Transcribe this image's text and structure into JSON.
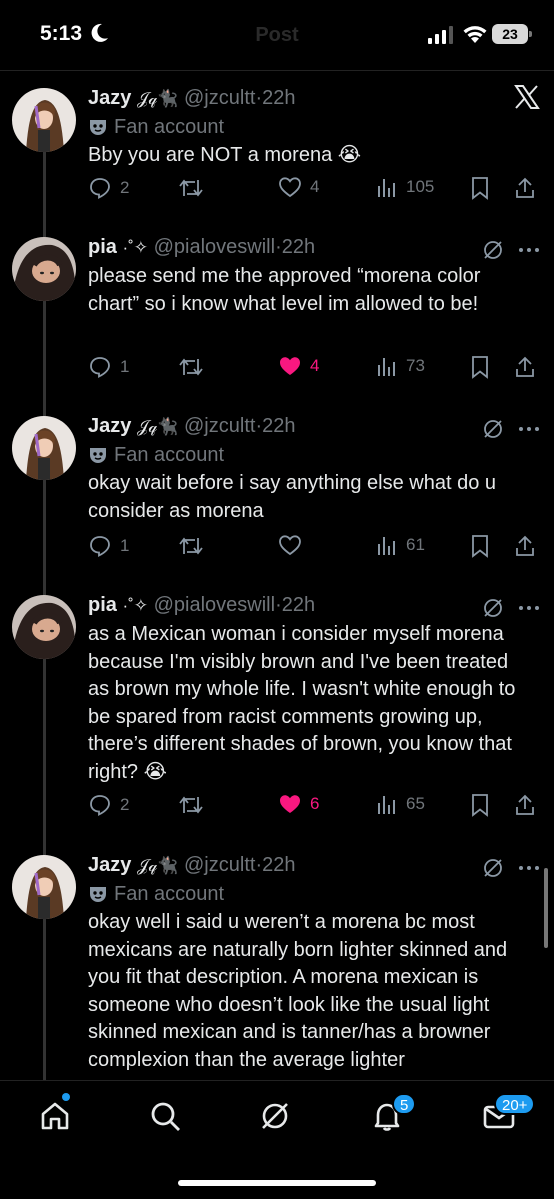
{
  "status": {
    "time": "5:13",
    "battery": "23",
    "ghost_title": "Post"
  },
  "tweets": [
    {
      "name": "Jazy",
      "name_deco": "𝒥𝓆🐈‍⬛",
      "handle": "@jzcultt",
      "time": "22h",
      "fan_label": "Fan account",
      "text": "Bby you are NOT a morena 😭",
      "replies": "2",
      "retweets": "",
      "likes": "4",
      "liked": false,
      "views": "105"
    },
    {
      "name": "pia",
      "name_deco": "·˚✧",
      "handle": "@pialoveswill",
      "time": "22h",
      "text": "please send me the approved “morena color chart” so i know what level im allowed to be!",
      "replies": "1",
      "retweets": "",
      "likes": "4",
      "liked": true,
      "views": "73"
    },
    {
      "name": "Jazy",
      "name_deco": "𝒥𝓆🐈‍⬛",
      "handle": "@jzcultt",
      "time": "22h",
      "fan_label": "Fan account",
      "text": "okay wait before i say anything else what do u consider as morena",
      "replies": "1",
      "retweets": "",
      "likes": "",
      "liked": false,
      "views": "61"
    },
    {
      "name": "pia",
      "name_deco": "·˚✧",
      "handle": "@pialoveswill",
      "time": "22h",
      "text": "as a Mexican woman i consider myself morena because I'm visibly brown and I've been treated as brown my whole life. I wasn't white enough to be spared from racist comments growing up, there’s different shades of brown, you know that right? 😭",
      "replies": "2",
      "retweets": "",
      "likes": "6",
      "liked": true,
      "views": "65"
    },
    {
      "name": "Jazy",
      "name_deco": "𝒥𝓆🐈‍⬛",
      "handle": "@jzcultt",
      "time": "22h",
      "fan_label": "Fan account",
      "text": "okay well i said u weren’t a morena bc most mexicans are naturally born lighter skinned and you fit that description. A morena mexican is someone who doesn’t look like the usual light skinned mexican and is tanner/has a browner complexion than the average lighter"
    }
  ],
  "nav": {
    "notifications_badge": "5",
    "messages_badge": "20+"
  },
  "icons": {
    "x_logo": "x-logo-icon",
    "grok": "grok-icon",
    "more": "more-icon",
    "reply": "reply-icon",
    "retweet": "retweet-icon",
    "like": "heart-icon",
    "views": "views-icon",
    "bookmark": "bookmark-icon",
    "share": "share-icon"
  },
  "colors": {
    "accent": "#1d9bf0",
    "like": "#f91880",
    "muted": "#71767b"
  }
}
